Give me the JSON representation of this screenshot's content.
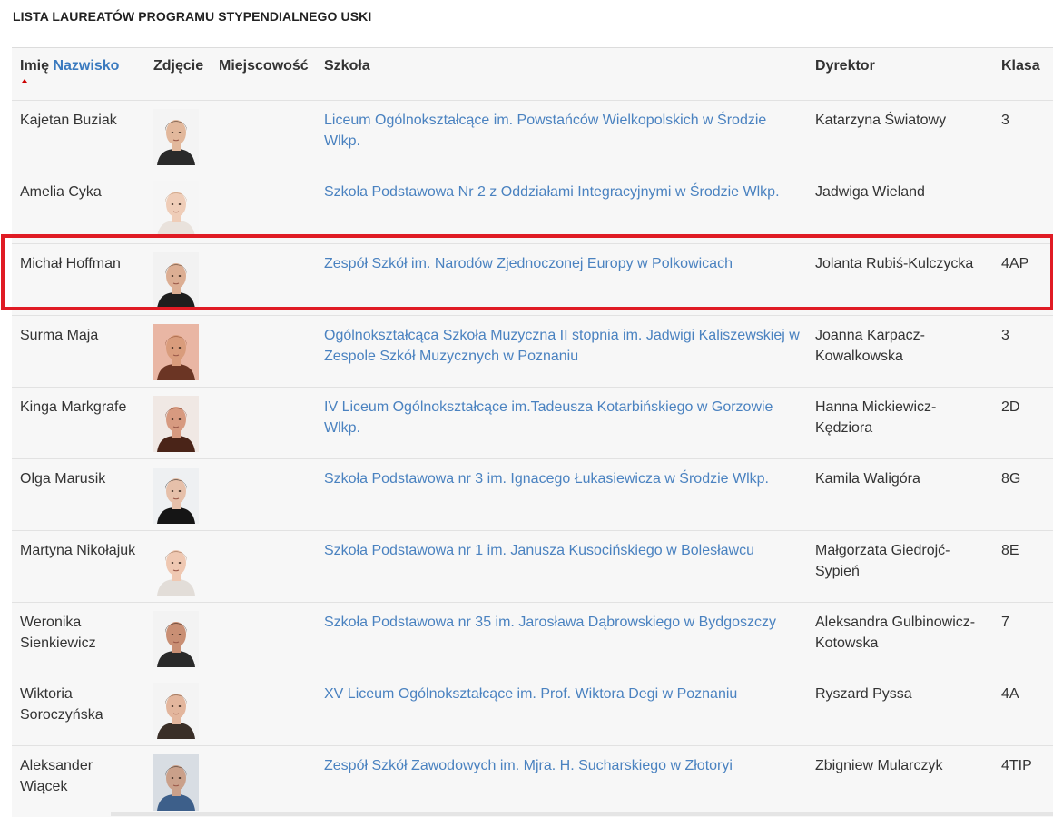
{
  "page_title": "LISTA LAUREATÓW PROGRAMU STYPENDIALNEGO USKI",
  "columns": {
    "name_first": "Imię",
    "name_last": "Nazwisko",
    "photo": "Zdjęcie",
    "city": "Miejscowość",
    "school": "Szkoła",
    "director": "Dyrektor",
    "class": "Klasa"
  },
  "rows": [
    {
      "name": "Kajetan Buziak",
      "city": "",
      "school": "Liceum Ogólnokształcące im. Powstańców Wielkopolskich w Środzie Wlkp.",
      "director": "Katarzyna Światowy",
      "class": "3",
      "photo": {
        "bg": "#f4f4f4",
        "hair": "#3b2a1f",
        "skin": "#e2b89c",
        "shirt": "#2a2a2a"
      }
    },
    {
      "name": "Amelia Cyka",
      "city": "",
      "school": "Szkoła Podstawowa Nr 2 z Oddziałami Integracyjnymi w Środzie Wlkp.",
      "director": "Jadwiga Wieland",
      "class": "",
      "photo": {
        "bg": "#f6f6f6",
        "hair": "#b88d6a",
        "skin": "#efcdb8",
        "shirt": "#e9e2dc"
      }
    },
    {
      "name": "Michał Hoffman",
      "city": "",
      "school": "Zespół Szkół im. Narodów Zjednoczonej Europy w Polkowicach",
      "director": "Jolanta Rubiś-Kulczycka",
      "class": "4AP",
      "photo": {
        "bg": "#f2f2f2",
        "hair": "#4a3426",
        "skin": "#dcae93",
        "shirt": "#1e1e1e"
      }
    },
    {
      "name": "Surma Maja",
      "city": "",
      "school": "Ogólnokształcąca Szkoła Muzyczna II stopnia im. Jadwigi Kaliszewskiej w Zespole Szkół Muzycznych w Poznaniu",
      "director": "Joanna Karpacz-Kowalkowska",
      "class": "3",
      "photo": {
        "bg": "#e9b6a4",
        "hair": "#8b4a2e",
        "skin": "#d99c7c",
        "shirt": "#6b3524"
      }
    },
    {
      "name": "Kinga Markgrafe",
      "city": "",
      "school": "IV Liceum Ogólnokształcące im.Tadeusza Kotarbińskiego w Gorzowie Wlkp.",
      "director": "Hanna Mickiewicz-Kędziora",
      "class": "2D",
      "photo": {
        "bg": "#f0e8e4",
        "hair": "#6e2f1d",
        "skin": "#d79a80",
        "shirt": "#4a2418"
      }
    },
    {
      "name": "Olga Marusik",
      "city": "",
      "school": "Szkoła Podstawowa nr 3 im. Ignacego Łukasiewicza w Środzie Wlkp.",
      "director": "Kamila Waligóra",
      "class": "8G",
      "photo": {
        "bg": "#eef0f2",
        "hair": "#1c1612",
        "skin": "#e6c0aa",
        "shirt": "#151515"
      }
    },
    {
      "name": "Martyna Nikołajuk",
      "city": "",
      "school": "Szkoła Podstawowa nr 1 im. Janusza Kusocińskiego w Bolesławcu",
      "director": "Małgorzata Giedrojć-Sypień",
      "class": "8E",
      "photo": {
        "bg": "#f7f7f7",
        "hair": "#8a6248",
        "skin": "#efc8b2",
        "shirt": "#e2ddd8"
      }
    },
    {
      "name": "Weronika Sienkiewicz",
      "city": "",
      "school": "Szkoła Podstawowa nr 35 im. Jarosława Dąbrowskiego w Bydgoszczy",
      "director": "Aleksandra Gulbinowicz-Kotowska",
      "class": "7",
      "photo": {
        "bg": "#f3f3f3",
        "hair": "#2a1b14",
        "skin": "#c98f74",
        "shirt": "#2a2a2a"
      }
    },
    {
      "name": "Wiktoria Soroczyńska",
      "city": "",
      "school": "XV Liceum Ogólnokształcące im. Prof. Wiktora Degi w Poznaniu",
      "director": "Ryszard Pyssa",
      "class": "4A",
      "photo": {
        "bg": "#f4f4f4",
        "hair": "#6a4a34",
        "skin": "#e3b69d",
        "shirt": "#3a2f28"
      }
    },
    {
      "name": "Aleksander Wiącek",
      "city": "",
      "school": "Zespół Szkół Zawodowych im. Mjra. H. Sucharskiego w Złotoryi",
      "director": "Zbigniew Mularczyk",
      "class": "4TIP",
      "photo": {
        "bg": "#d8dde3",
        "hair": "#2b2420",
        "skin": "#caa08a",
        "shirt": "#3d5f8a"
      }
    }
  ],
  "highlight_color": "#e01b24",
  "link_color": "#4a82c0"
}
